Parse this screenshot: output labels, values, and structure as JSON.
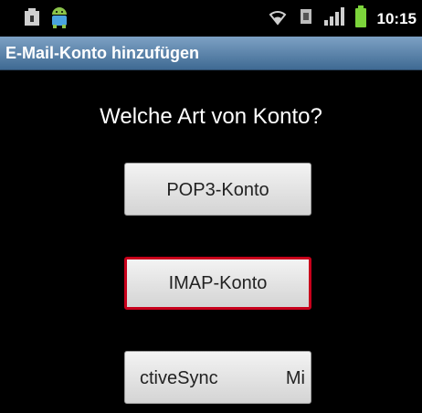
{
  "status_bar": {
    "time": "10:15",
    "icons": [
      "sd-card-icon",
      "android-icon",
      "wifi-icon",
      "sync-icon",
      "signal-icon",
      "battery-icon"
    ]
  },
  "title_bar": {
    "title": "E-Mail-Konto hinzufügen"
  },
  "main": {
    "prompt": "Welche Art von Konto?",
    "buttons": [
      {
        "label": "POP3-Konto"
      },
      {
        "label": "IMAP-Konto"
      },
      {
        "label_left": "ctiveSync",
        "label_right": "Mi"
      }
    ]
  },
  "colors": {
    "title_bar_top": "#7da1c4",
    "title_bar_bottom": "#3f6a93",
    "focus_border": "#c8001b",
    "battery": "#7cd43b",
    "android": "#8bc34a"
  }
}
